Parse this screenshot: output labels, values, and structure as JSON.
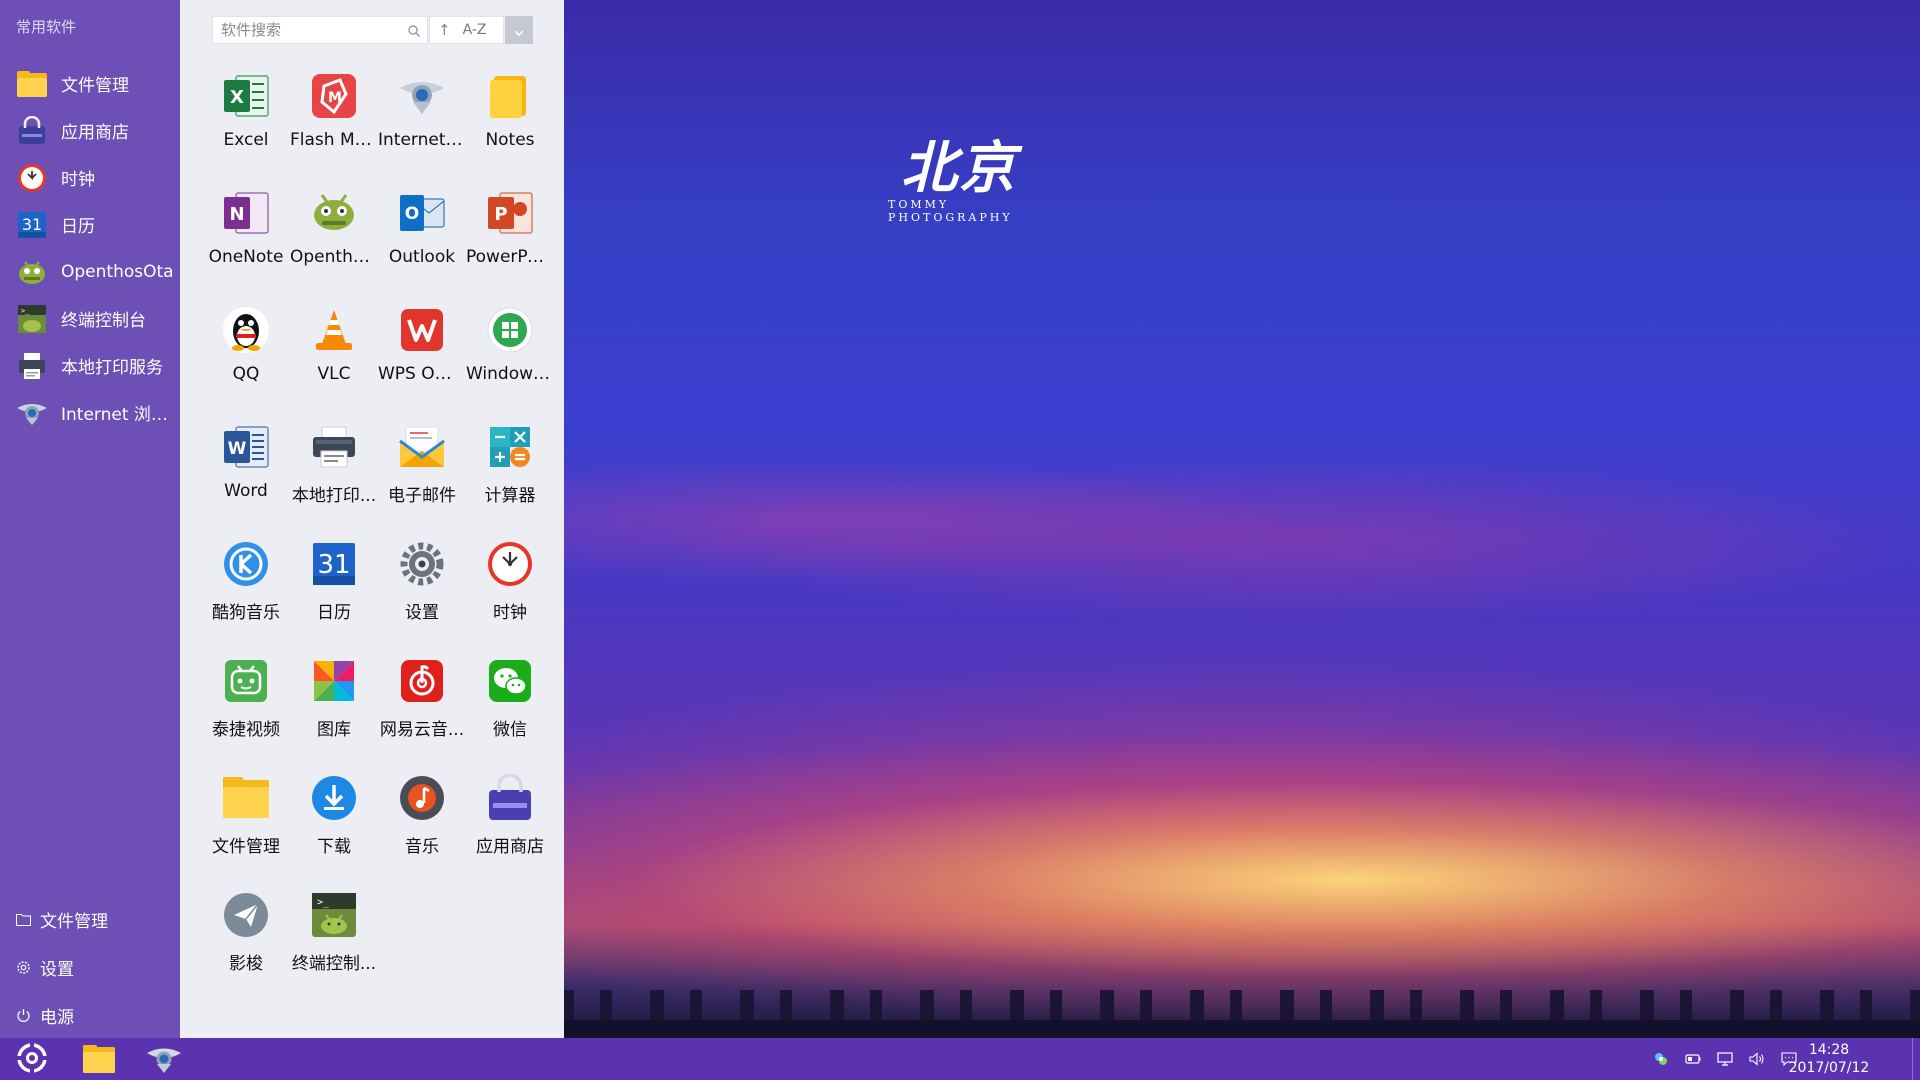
{
  "start_menu": {
    "section_title": "常用软件",
    "favorites": [
      {
        "label": "文件管理",
        "icon": "folder-icon"
      },
      {
        "label": "应用商店",
        "icon": "app-store-icon"
      },
      {
        "label": "时钟",
        "icon": "clock-icon"
      },
      {
        "label": "日历",
        "icon": "calendar-icon"
      },
      {
        "label": "OpenthosOta",
        "icon": "android-ota-icon"
      },
      {
        "label": "终端控制台",
        "icon": "terminal-icon"
      },
      {
        "label": "本地打印服务",
        "icon": "printer-icon"
      },
      {
        "label": "Internet 浏览...",
        "icon": "browser-icon"
      }
    ],
    "bottom": [
      {
        "label": "文件管理",
        "icon": "folder-outline-icon"
      },
      {
        "label": "设置",
        "icon": "gear-icon"
      },
      {
        "label": "电源",
        "icon": "power-icon"
      }
    ],
    "search_placeholder": "软件搜索",
    "sort_label": "A-Z",
    "apps": [
      {
        "label": "Excel",
        "icon": "excel-icon"
      },
      {
        "label": "Flash Ma...",
        "icon": "flash-manager-icon"
      },
      {
        "label": "Internet ...",
        "icon": "browser-icon"
      },
      {
        "label": "Notes",
        "icon": "notes-icon"
      },
      {
        "label": "OneNote",
        "icon": "onenote-icon"
      },
      {
        "label": "Opentho...",
        "icon": "android-ota-icon"
      },
      {
        "label": "Outlook",
        "icon": "outlook-icon"
      },
      {
        "label": "PowerPoi...",
        "icon": "powerpoint-icon"
      },
      {
        "label": "QQ",
        "icon": "qq-penguin-icon"
      },
      {
        "label": "VLC",
        "icon": "vlc-cone-icon"
      },
      {
        "label": "WPS Offi...",
        "icon": "wps-icon"
      },
      {
        "label": "Windows...",
        "icon": "windows-icon"
      },
      {
        "label": "Word",
        "icon": "word-icon"
      },
      {
        "label": "本地打印...",
        "icon": "printer-icon"
      },
      {
        "label": "电子邮件",
        "icon": "email-icon"
      },
      {
        "label": "计算器",
        "icon": "calculator-icon"
      },
      {
        "label": "酷狗音乐",
        "icon": "kugou-icon"
      },
      {
        "label": "日历",
        "icon": "calendar-icon"
      },
      {
        "label": "设置",
        "icon": "gear-icon"
      },
      {
        "label": "时钟",
        "icon": "clock-icon"
      },
      {
        "label": "泰捷视频",
        "icon": "video-icon"
      },
      {
        "label": "图库",
        "icon": "gallery-icon"
      },
      {
        "label": "网易云音...",
        "icon": "netease-music-icon"
      },
      {
        "label": "微信",
        "icon": "wechat-icon"
      },
      {
        "label": "文件管理",
        "icon": "folder-icon"
      },
      {
        "label": "下载",
        "icon": "download-icon"
      },
      {
        "label": "音乐",
        "icon": "music-icon"
      },
      {
        "label": "应用商店",
        "icon": "app-store-icon"
      },
      {
        "label": "影梭",
        "icon": "paper-plane-icon"
      },
      {
        "label": "终端控制...",
        "icon": "terminal-icon"
      }
    ]
  },
  "wallpaper": {
    "watermark_title": "北京",
    "watermark_line1": "TOMMY",
    "watermark_line2": "PHOTOGRAPHY"
  },
  "taskbar": {
    "time": "14:28",
    "date": "2017/07/12"
  },
  "colors": {
    "menu_left_bg": "#6e4fb5",
    "menu_right_bg": "#eceef3",
    "taskbar_bg": "#5b33b1"
  }
}
